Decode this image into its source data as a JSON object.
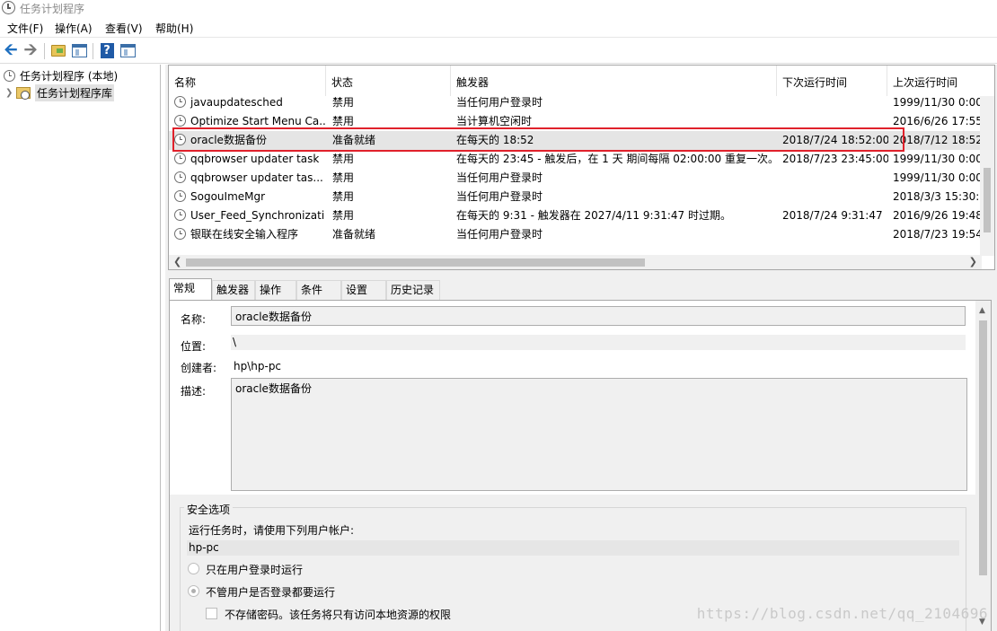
{
  "window": {
    "title": "任务计划程序"
  },
  "menu": {
    "file": "文件(F)",
    "action": "操作(A)",
    "view": "查看(V)",
    "help": "帮助(H)"
  },
  "toolbar": {
    "help_glyph": "?"
  },
  "tree": {
    "root": "任务计划程序 (本地)",
    "library": "任务计划程序库"
  },
  "tasklist": {
    "columns": {
      "name": "名称",
      "status": "状态",
      "trigger": "触发器",
      "next_run": "下次运行时间",
      "last_run": "上次运行时间"
    },
    "rows": [
      {
        "name": "javaupdatesched",
        "status": "禁用",
        "trigger": "当任何用户登录时",
        "next_run": "",
        "last_run": "1999/11/30 0:00"
      },
      {
        "name": "Optimize Start Menu Ca...",
        "status": "禁用",
        "trigger": "当计算机空闲时",
        "next_run": "",
        "last_run": "2016/6/26 17:55"
      },
      {
        "name": "oracle数据备份",
        "status": "准备就绪",
        "trigger": "在每天的 18:52",
        "next_run": "2018/7/24 18:52:00",
        "last_run": "2018/7/12 18:52"
      },
      {
        "name": "qqbrowser updater task",
        "status": "禁用",
        "trigger": "在每天的 23:45 - 触发后，在 1 天 期间每隔 02:00:00 重复一次。",
        "next_run": "2018/7/23 23:45:00",
        "last_run": "1999/11/30 0:00"
      },
      {
        "name": "qqbrowser updater tas...",
        "status": "禁用",
        "trigger": "当任何用户登录时",
        "next_run": "",
        "last_run": "1999/11/30 0:00"
      },
      {
        "name": "SogouImeMgr",
        "status": "禁用",
        "trigger": "当任何用户登录时",
        "next_run": "",
        "last_run": "2018/3/3 15:30:"
      },
      {
        "name": "User_Feed_Synchronizati...",
        "status": "禁用",
        "trigger": "在每天的 9:31 - 触发器在 2027/4/11 9:31:47 时过期。",
        "next_run": "2018/7/24 9:31:47",
        "last_run": "2016/9/26 19:48"
      },
      {
        "name": "银联在线安全输入程序",
        "status": "准备就绪",
        "trigger": "当任何用户登录时",
        "next_run": "",
        "last_run": "2018/7/23 19:54"
      }
    ],
    "selected_index": 2
  },
  "tabs": [
    "常规",
    "触发器",
    "操作",
    "条件",
    "设置",
    "历史记录"
  ],
  "general": {
    "name_label": "名称:",
    "name_value": "oracle数据备份",
    "location_label": "位置:",
    "location_value": "\\",
    "author_label": "创建者:",
    "author_value": "hp\\hp-pc",
    "description_label": "描述:",
    "description_value": "oracle数据备份"
  },
  "security": {
    "title": "安全选项",
    "run_as_label": "运行任务时，请使用下列用户帐户:",
    "run_as_user": "hp-pc",
    "option_logged_on": "只在用户登录时运行",
    "option_whether_logged": "不管用户是否登录都要运行",
    "option_no_store_password": "不存储密码。该任务将只有访问本地资源的权限",
    "selected_option": "option_whether_logged"
  },
  "watermark": "https://blog.csdn.net/qq_2104696"
}
